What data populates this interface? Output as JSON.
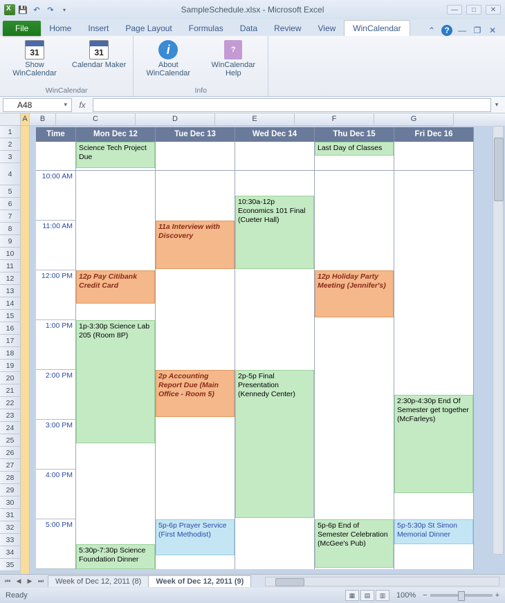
{
  "window": {
    "title": "SampleSchedule.xlsx - Microsoft Excel"
  },
  "ribbon": {
    "tabs": {
      "file": "File",
      "home": "Home",
      "insert": "Insert",
      "pagelayout": "Page Layout",
      "formulas": "Formulas",
      "data": "Data",
      "review": "Review",
      "view": "View",
      "wincal": "WinCalendar"
    },
    "groups": {
      "wincal_label": "WinCalendar",
      "info_label": "Info",
      "show": "Show WinCalendar",
      "maker": "Calendar Maker",
      "about": "About WinCalendar",
      "help": "WinCalendar Help"
    },
    "showcal_num": "31",
    "maker_num": "31"
  },
  "namebox": "A48",
  "fx_label": "fx",
  "columns": {
    "a": "A",
    "b": "B",
    "c": "C",
    "d": "D",
    "e": "E",
    "f": "F",
    "g": "G"
  },
  "rows": [
    "1",
    "2",
    "3",
    "4",
    "5",
    "6",
    "7",
    "8",
    "9",
    "10",
    "11",
    "12",
    "13",
    "14",
    "15",
    "16",
    "17",
    "18",
    "19",
    "20",
    "21",
    "22",
    "23",
    "24",
    "25",
    "26",
    "27",
    "28",
    "29",
    "30",
    "31",
    "32",
    "33",
    "34",
    "35"
  ],
  "calendar": {
    "header": {
      "time": "Time",
      "mon": "Mon Dec 12",
      "tue": "Tue Dec 13",
      "wed": "Wed Dec 14",
      "thu": "Thu Dec 15",
      "fri": "Fri Dec 16"
    },
    "hours": {
      "h10": "10:00 AM",
      "h11": "11:00 AM",
      "h12": "12:00 PM",
      "h1": "1:00 PM",
      "h2": "2:00 PM",
      "h3": "3:00 PM",
      "h4": "4:00 PM",
      "h5": "5:00 PM"
    },
    "events": {
      "mon_allday": "Science Tech Project Due",
      "thu_allday": "Last Day of Classes",
      "wed_1030": "10:30a-12p Economics 101 Final (Cueter Hall)",
      "tue_11a": "11a Interview with Discovery",
      "mon_12p": "12p Pay Citibank Credit Card",
      "thu_12p": "12p Holiday Party Meeting (Jennifer's)",
      "mon_1p": "1p-3:30p Science Lab 205 (Room 8P)",
      "tue_2p": "2p Accounting Report Due (Main Office - Room 5)",
      "wed_2p": "2p-5p Final Presentation (Kennedy Center)",
      "fri_230": "2:30p-4:30p End Of Semester get together (McFarleys)",
      "tue_5p": "5p-6p Prayer Service (First Methodist)",
      "thu_5p": "5p-6p End of Semester Celebration (McGee's Pub)",
      "fri_5p": "5p-5:30p St Simon Memorial Dinner",
      "mon_530": "5:30p-7:30p Science Foundation Dinner"
    }
  },
  "sheet_tabs": {
    "prev": "Week of Dec 12, 2011 (8)",
    "curr": "Week of Dec 12, 2011 (9)"
  },
  "status": {
    "ready": "Ready",
    "zoom": "100%"
  }
}
